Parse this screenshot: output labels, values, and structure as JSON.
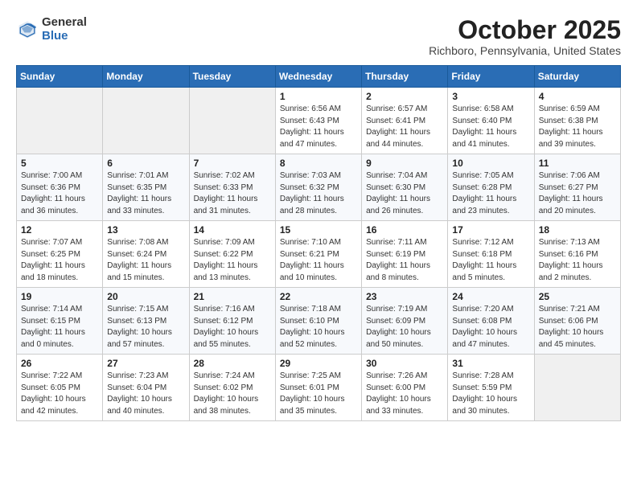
{
  "header": {
    "logo_general": "General",
    "logo_blue": "Blue",
    "month": "October 2025",
    "location": "Richboro, Pennsylvania, United States"
  },
  "calendar": {
    "days_of_week": [
      "Sunday",
      "Monday",
      "Tuesday",
      "Wednesday",
      "Thursday",
      "Friday",
      "Saturday"
    ],
    "weeks": [
      [
        {
          "day": "",
          "info": ""
        },
        {
          "day": "",
          "info": ""
        },
        {
          "day": "",
          "info": ""
        },
        {
          "day": "1",
          "info": "Sunrise: 6:56 AM\nSunset: 6:43 PM\nDaylight: 11 hours\nand 47 minutes."
        },
        {
          "day": "2",
          "info": "Sunrise: 6:57 AM\nSunset: 6:41 PM\nDaylight: 11 hours\nand 44 minutes."
        },
        {
          "day": "3",
          "info": "Sunrise: 6:58 AM\nSunset: 6:40 PM\nDaylight: 11 hours\nand 41 minutes."
        },
        {
          "day": "4",
          "info": "Sunrise: 6:59 AM\nSunset: 6:38 PM\nDaylight: 11 hours\nand 39 minutes."
        }
      ],
      [
        {
          "day": "5",
          "info": "Sunrise: 7:00 AM\nSunset: 6:36 PM\nDaylight: 11 hours\nand 36 minutes."
        },
        {
          "day": "6",
          "info": "Sunrise: 7:01 AM\nSunset: 6:35 PM\nDaylight: 11 hours\nand 33 minutes."
        },
        {
          "day": "7",
          "info": "Sunrise: 7:02 AM\nSunset: 6:33 PM\nDaylight: 11 hours\nand 31 minutes."
        },
        {
          "day": "8",
          "info": "Sunrise: 7:03 AM\nSunset: 6:32 PM\nDaylight: 11 hours\nand 28 minutes."
        },
        {
          "day": "9",
          "info": "Sunrise: 7:04 AM\nSunset: 6:30 PM\nDaylight: 11 hours\nand 26 minutes."
        },
        {
          "day": "10",
          "info": "Sunrise: 7:05 AM\nSunset: 6:28 PM\nDaylight: 11 hours\nand 23 minutes."
        },
        {
          "day": "11",
          "info": "Sunrise: 7:06 AM\nSunset: 6:27 PM\nDaylight: 11 hours\nand 20 minutes."
        }
      ],
      [
        {
          "day": "12",
          "info": "Sunrise: 7:07 AM\nSunset: 6:25 PM\nDaylight: 11 hours\nand 18 minutes."
        },
        {
          "day": "13",
          "info": "Sunrise: 7:08 AM\nSunset: 6:24 PM\nDaylight: 11 hours\nand 15 minutes."
        },
        {
          "day": "14",
          "info": "Sunrise: 7:09 AM\nSunset: 6:22 PM\nDaylight: 11 hours\nand 13 minutes."
        },
        {
          "day": "15",
          "info": "Sunrise: 7:10 AM\nSunset: 6:21 PM\nDaylight: 11 hours\nand 10 minutes."
        },
        {
          "day": "16",
          "info": "Sunrise: 7:11 AM\nSunset: 6:19 PM\nDaylight: 11 hours\nand 8 minutes."
        },
        {
          "day": "17",
          "info": "Sunrise: 7:12 AM\nSunset: 6:18 PM\nDaylight: 11 hours\nand 5 minutes."
        },
        {
          "day": "18",
          "info": "Sunrise: 7:13 AM\nSunset: 6:16 PM\nDaylight: 11 hours\nand 2 minutes."
        }
      ],
      [
        {
          "day": "19",
          "info": "Sunrise: 7:14 AM\nSunset: 6:15 PM\nDaylight: 11 hours\nand 0 minutes."
        },
        {
          "day": "20",
          "info": "Sunrise: 7:15 AM\nSunset: 6:13 PM\nDaylight: 10 hours\nand 57 minutes."
        },
        {
          "day": "21",
          "info": "Sunrise: 7:16 AM\nSunset: 6:12 PM\nDaylight: 10 hours\nand 55 minutes."
        },
        {
          "day": "22",
          "info": "Sunrise: 7:18 AM\nSunset: 6:10 PM\nDaylight: 10 hours\nand 52 minutes."
        },
        {
          "day": "23",
          "info": "Sunrise: 7:19 AM\nSunset: 6:09 PM\nDaylight: 10 hours\nand 50 minutes."
        },
        {
          "day": "24",
          "info": "Sunrise: 7:20 AM\nSunset: 6:08 PM\nDaylight: 10 hours\nand 47 minutes."
        },
        {
          "day": "25",
          "info": "Sunrise: 7:21 AM\nSunset: 6:06 PM\nDaylight: 10 hours\nand 45 minutes."
        }
      ],
      [
        {
          "day": "26",
          "info": "Sunrise: 7:22 AM\nSunset: 6:05 PM\nDaylight: 10 hours\nand 42 minutes."
        },
        {
          "day": "27",
          "info": "Sunrise: 7:23 AM\nSunset: 6:04 PM\nDaylight: 10 hours\nand 40 minutes."
        },
        {
          "day": "28",
          "info": "Sunrise: 7:24 AM\nSunset: 6:02 PM\nDaylight: 10 hours\nand 38 minutes."
        },
        {
          "day": "29",
          "info": "Sunrise: 7:25 AM\nSunset: 6:01 PM\nDaylight: 10 hours\nand 35 minutes."
        },
        {
          "day": "30",
          "info": "Sunrise: 7:26 AM\nSunset: 6:00 PM\nDaylight: 10 hours\nand 33 minutes."
        },
        {
          "day": "31",
          "info": "Sunrise: 7:28 AM\nSunset: 5:59 PM\nDaylight: 10 hours\nand 30 minutes."
        },
        {
          "day": "",
          "info": ""
        }
      ]
    ]
  }
}
